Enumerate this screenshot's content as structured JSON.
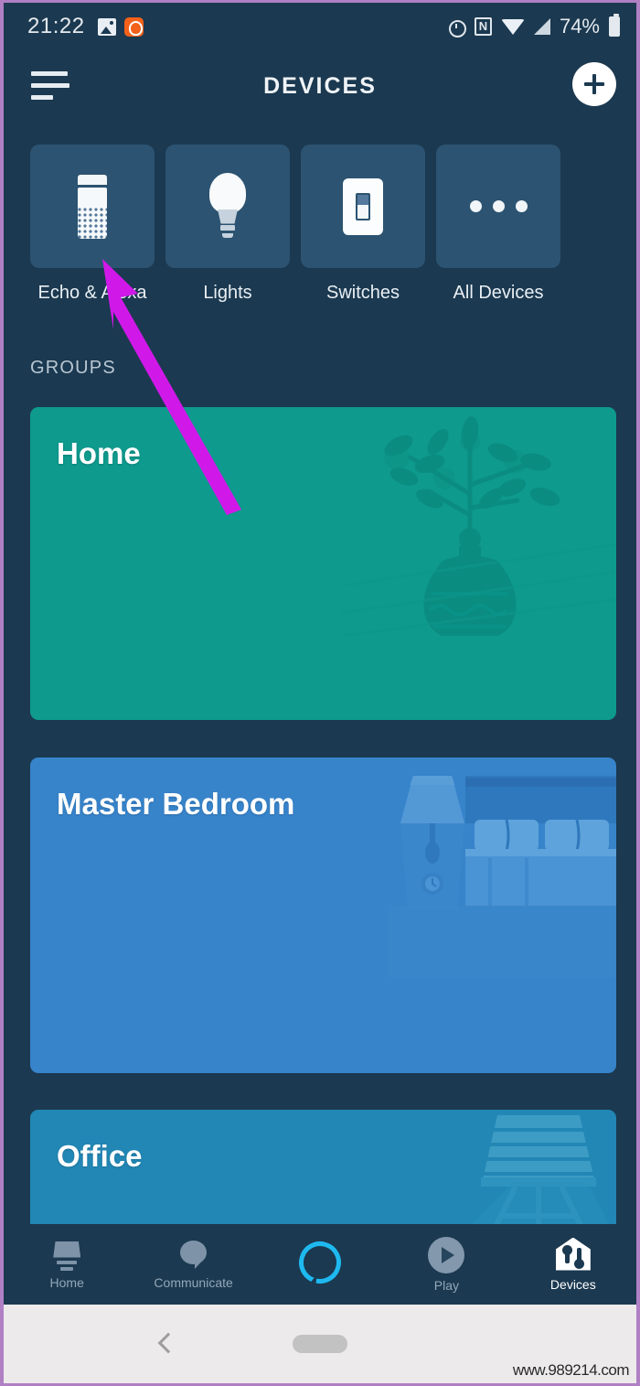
{
  "status_bar": {
    "time": "21:22",
    "battery_percent": "74%",
    "icons": [
      "photo-icon",
      "orange-app-icon",
      "alarm-icon",
      "nfc-icon",
      "wifi-icon",
      "cellular-signal-icon",
      "battery-icon"
    ]
  },
  "app_bar": {
    "menu_icon": "hamburger-menu-icon",
    "title": "DEVICES",
    "add_icon": "plus-circle-icon"
  },
  "categories": [
    {
      "label": "Echo & Alexa",
      "icon": "echo-speaker-icon"
    },
    {
      "label": "Lights",
      "icon": "light-bulb-icon"
    },
    {
      "label": "Switches",
      "icon": "light-switch-icon"
    },
    {
      "label": "All Devices",
      "icon": "ellipsis-icon"
    }
  ],
  "groups": {
    "section_label": "GROUPS",
    "items": [
      {
        "name": "Home",
        "color": "#0e9a8d",
        "art": "potted-plant-art"
      },
      {
        "name": "Master Bedroom",
        "color": "#3784cb",
        "art": "bedroom-lamp-bed-art"
      },
      {
        "name": "Office",
        "color": "#2287b5",
        "art": "floor-lamp-art"
      }
    ]
  },
  "bottom_nav": {
    "items": [
      {
        "label": "Home",
        "icon": "feed-home-icon",
        "active": false
      },
      {
        "label": "Communicate",
        "icon": "speech-bubble-icon",
        "active": false
      },
      {
        "label": "",
        "icon": "alexa-ring-icon",
        "active": false
      },
      {
        "label": "Play",
        "icon": "play-circle-icon",
        "active": false
      },
      {
        "label": "Devices",
        "icon": "house-controls-icon",
        "active": true
      }
    ]
  },
  "system_bar": {
    "back_icon": "back-chevron-icon",
    "home_pill": "home-pill-indicator"
  },
  "annotation": {
    "arrow_color": "#d019e8",
    "points_to": "Echo & Alexa"
  },
  "watermark": "www.989214.com"
}
